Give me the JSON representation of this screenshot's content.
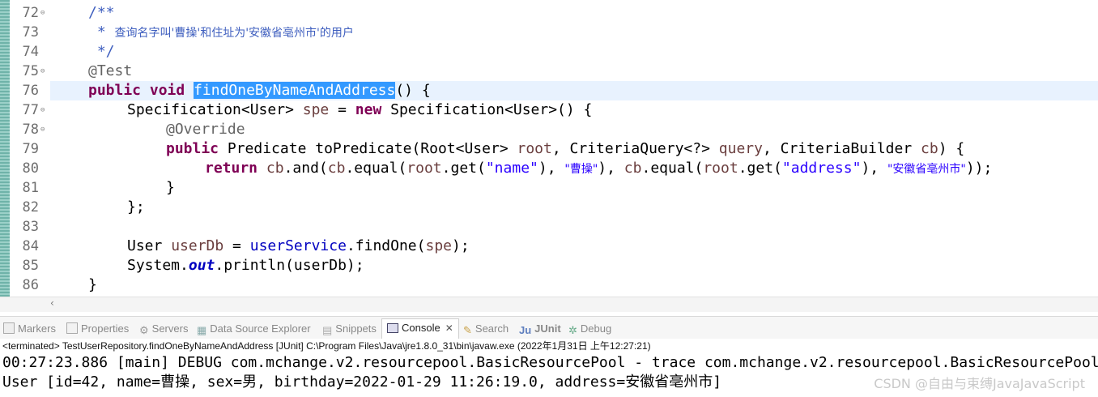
{
  "editor": {
    "line_numbers": [
      "72",
      "73",
      "74",
      "75",
      "76",
      "77",
      "78",
      "79",
      "80",
      "81",
      "82",
      "83",
      "84",
      "85",
      "86"
    ],
    "lines": {
      "l72": "/**",
      "l73_star": " * ",
      "l73_text": "查询名字叫'曹操'和住址为'安徽省亳州市'的用户",
      "l74": " */",
      "l75": "@Test",
      "l76_kw1": "public",
      "l76_kw2": "void",
      "l76_method": "findOneByNameAndAddress",
      "l76_rest": "() {",
      "l77_a": "Specification<User> ",
      "l77_var": "spe",
      "l77_b": " = ",
      "l77_kw": "new",
      "l77_c": " Specification<User>() {",
      "l78": "@Override",
      "l79_kw": "public",
      "l79_a": " Predicate toPredicate(Root<User> ",
      "l79_root": "root",
      "l79_b": ", CriteriaQuery<?> ",
      "l79_query": "query",
      "l79_c": ", CriteriaBuilder ",
      "l79_cb": "cb",
      "l79_d": ") {",
      "l80_kw": "return",
      "l80_cb1": "cb",
      "l80_a": ".and(",
      "l80_cb2": "cb",
      "l80_b": ".equal(",
      "l80_root1": "root",
      "l80_c": ".get(",
      "l80_s1": "\"name\"",
      "l80_d": "), ",
      "l80_s2": "\"曹操\"",
      "l80_e": "), ",
      "l80_cb3": "cb",
      "l80_f": ".equal(",
      "l80_root2": "root",
      "l80_g": ".get(",
      "l80_s3": "\"address\"",
      "l80_h": "), ",
      "l80_s4": "\"安徽省亳州市\"",
      "l80_i": "));",
      "l81": "}",
      "l82": "};",
      "l84_a": "User ",
      "l84_var": "userDb",
      "l84_b": " = ",
      "l84_fld": "userService",
      "l84_c": ".findOne(",
      "l84_spe": "spe",
      "l84_d": ");",
      "l85_a": "System.",
      "l85_out": "out",
      "l85_b": ".println(userDb);",
      "l86": "}"
    }
  },
  "panel": {
    "tabs": [
      "Markers",
      "Properties",
      "Servers",
      "Data Source Explorer",
      "Snippets",
      "Console",
      "Search",
      "JUnit",
      "Debug"
    ],
    "active_tab": "Console",
    "close_glyph": "✕",
    "status": "<terminated> TestUserRepository.findOneByNameAndAddress [JUnit] C:\\Program Files\\Java\\jre1.8.0_31\\bin\\javaw.exe (2022年1月31日 上午12:27:21)"
  },
  "console": {
    "line1": "00:27:23.886 [main] DEBUG com.mchange.v2.resourcepool.BasicResourcePool - trace com.mchange.v2.resourcepool.BasicResourcePool",
    "line2": "User [id=42, name=曹操, sex=男, birthday=2022-01-29 11:26:19.0, address=安徽省亳州市]"
  },
  "watermark": "CSDN @自由与束缚JavaJavaScript",
  "colors": {
    "keyword": "#7f0055",
    "comment": "#3f5fbf",
    "string": "#2a00ff",
    "field": "#0000c0",
    "selection": "#3399ff"
  }
}
